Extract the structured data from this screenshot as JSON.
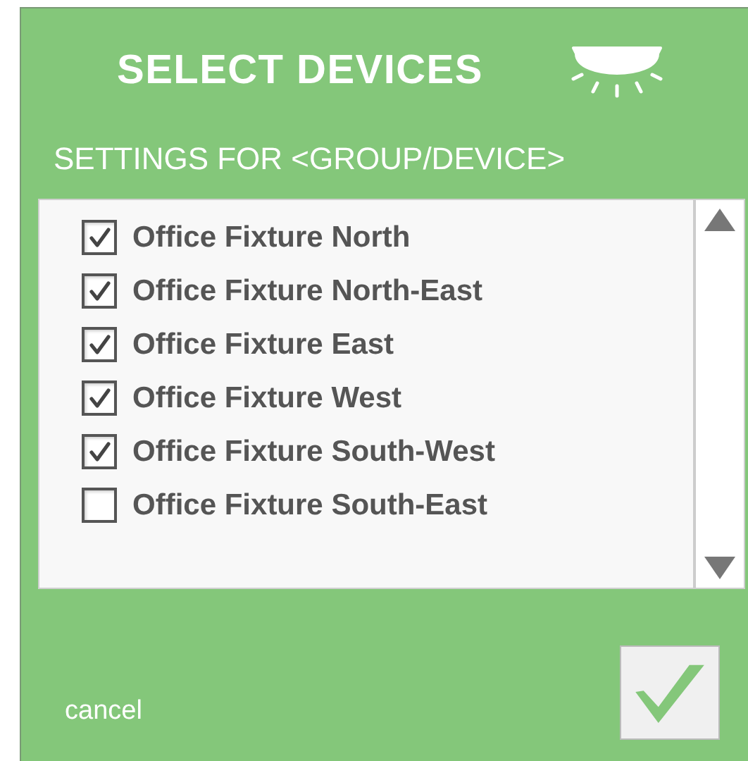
{
  "title": "SELECT DEVICES",
  "subtitle": "SETTINGS FOR <GROUP/DEVICE>",
  "devices": [
    {
      "label": "Office Fixture North",
      "checked": true
    },
    {
      "label": "Office Fixture North-East",
      "checked": true
    },
    {
      "label": "Office Fixture East",
      "checked": true
    },
    {
      "label": "Office Fixture West",
      "checked": true
    },
    {
      "label": "Office Fixture South-West",
      "checked": true
    },
    {
      "label": "Office Fixture South-East",
      "checked": false
    }
  ],
  "cancel": "cancel"
}
